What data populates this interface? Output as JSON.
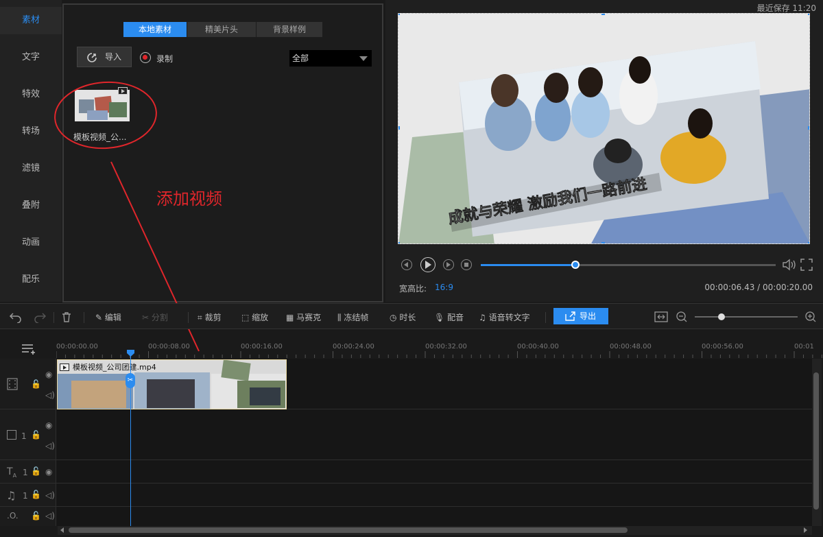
{
  "sidebar": {
    "items": [
      {
        "label": "素材"
      },
      {
        "label": "文字"
      },
      {
        "label": "特效"
      },
      {
        "label": "转场"
      },
      {
        "label": "滤镜"
      },
      {
        "label": "叠附"
      },
      {
        "label": "动画"
      },
      {
        "label": "配乐"
      }
    ]
  },
  "media": {
    "tabs": [
      {
        "label": "本地素材"
      },
      {
        "label": "精美片头"
      },
      {
        "label": "背景样例"
      }
    ],
    "import_label": "导入",
    "record_label": "录制",
    "filter_value": "全部",
    "items": [
      {
        "label": "模板视频_公..."
      }
    ]
  },
  "annotation": "添加视频",
  "preview": {
    "last_saved": "最近保存 11:20",
    "caption": "成就与荣耀 激励我们一路前进",
    "progress": 0.32,
    "aspect_label": "宽高比:",
    "aspect_value": "16:9",
    "timecode": "00:00:06.43 / 00:00:20.00"
  },
  "toolbar": {
    "edit": "编辑",
    "split": "分割",
    "crop": "裁剪",
    "zoom": "缩放",
    "mosaic": "马赛克",
    "freeze": "冻结帧",
    "duration": "时长",
    "voiceover": "配音",
    "speech_to_text": "语音转文字",
    "export": "导出",
    "zoom_level": 0.26
  },
  "timeline": {
    "ticks": [
      "00:00:00.00",
      "00:00:08.00",
      "00:00:16.00",
      "00:00:24.00",
      "00:00:32.00",
      "00:00:40.00",
      "00:00:48.00",
      "00:00:56.00",
      "00:01"
    ],
    "clip_title": "模板视频_公司团建.mp4",
    "track_numbers": [
      "1",
      "1",
      "1"
    ]
  },
  "colors": {
    "accent": "#2b8cf0",
    "annotation": "#e0262b"
  }
}
